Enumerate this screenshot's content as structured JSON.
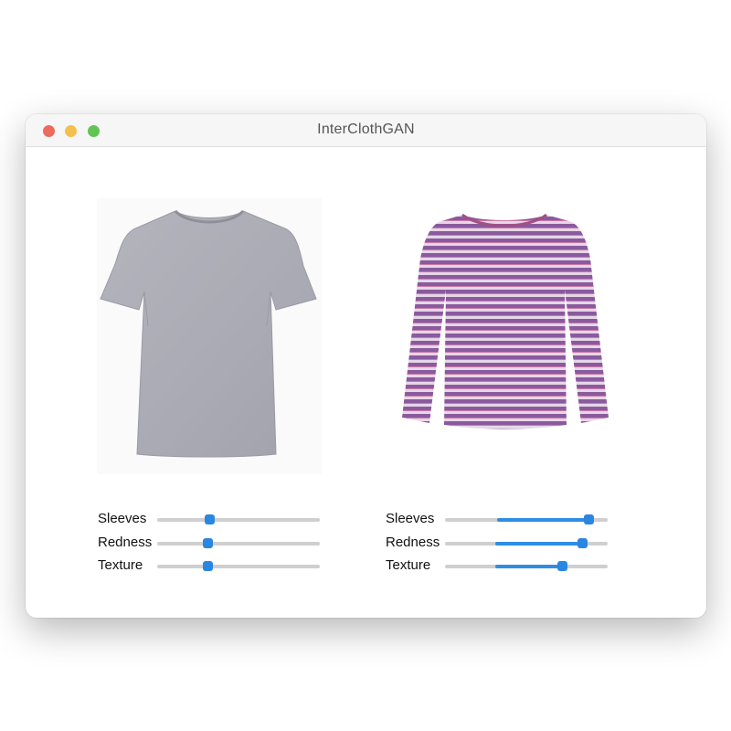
{
  "window": {
    "title": "InterClothGAN"
  },
  "accent_color": "#2f8de4",
  "panels": [
    {
      "garment": {
        "icon": "tshirt-gray-icon",
        "color": "#aeaeb8"
      },
      "sliders": [
        {
          "label": "Sleeves",
          "value": 0.32,
          "fill_from": 0.32
        },
        {
          "label": "Redness",
          "value": 0.31,
          "fill_from": 0.31
        },
        {
          "label": "Texture",
          "value": 0.31,
          "fill_from": 0.31
        }
      ]
    },
    {
      "garment": {
        "icon": "striped-longsleeve-icon",
        "color": "#b98ab8"
      },
      "sliders": [
        {
          "label": "Sleeves",
          "value": 0.88,
          "fill_from": 0.32
        },
        {
          "label": "Redness",
          "value": 0.84,
          "fill_from": 0.31
        },
        {
          "label": "Texture",
          "value": 0.72,
          "fill_from": 0.31
        }
      ]
    }
  ]
}
